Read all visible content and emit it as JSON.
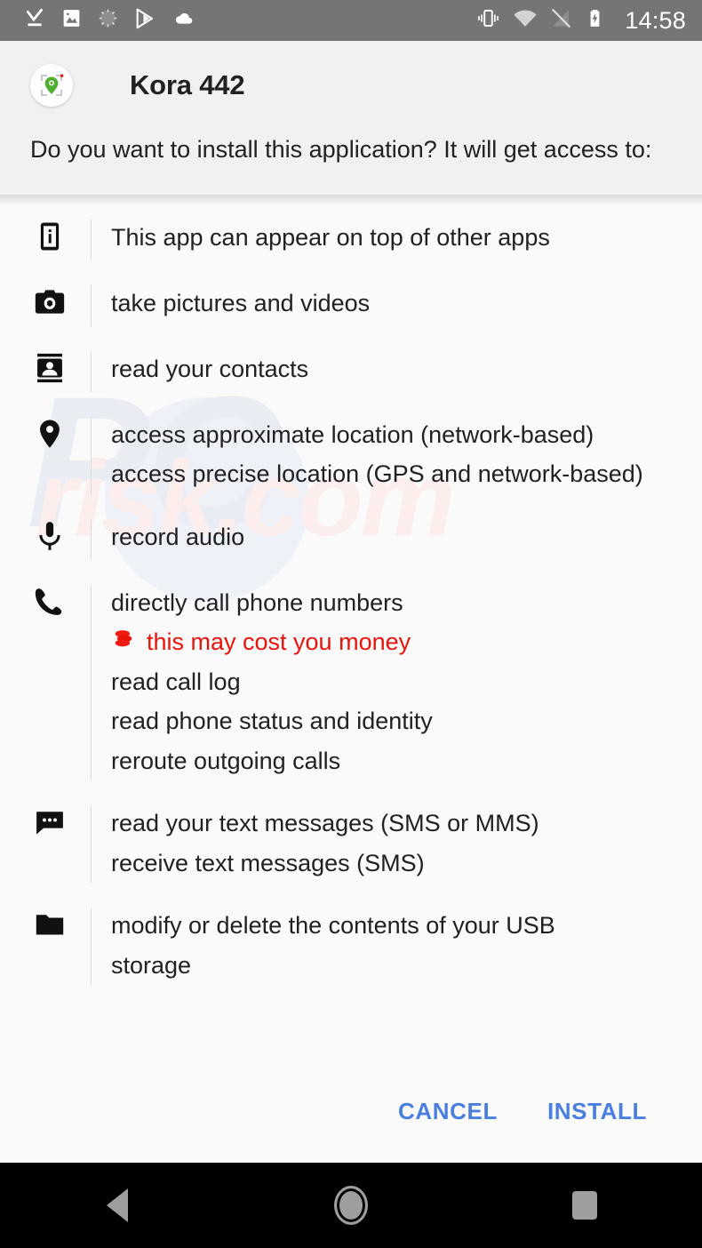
{
  "status_bar": {
    "background": "#757575",
    "left_icons": [
      {
        "name": "download-complete-icon",
        "label": "download complete"
      },
      {
        "name": "screenshot-image-icon",
        "label": "screenshot"
      },
      {
        "name": "loading-spinner-icon",
        "label": "syncing"
      },
      {
        "name": "google-play-icon",
        "label": "Google Play"
      },
      {
        "name": "cloud-icon",
        "label": "cloud"
      }
    ],
    "right_icons": [
      {
        "name": "vibrate-mode-icon",
        "label": "vibrate"
      },
      {
        "name": "wifi-icon",
        "label": "wifi"
      },
      {
        "name": "no-signal-icon",
        "label": "no cellular signal"
      },
      {
        "name": "battery-charging-icon",
        "label": "battery charging"
      }
    ],
    "clock": "14:58"
  },
  "header": {
    "background": "#f1f1f1",
    "app_name": "Kora 442",
    "app_icon_name": "kora-app-icon",
    "prompt": "Do you want to install this application? It will get access to:"
  },
  "permissions": [
    {
      "icon": "appear-on-top-icon",
      "lines": [
        {
          "text": "This app can appear on top of other apps",
          "warning": false
        }
      ]
    },
    {
      "icon": "camera-icon",
      "lines": [
        {
          "text": "take pictures and videos",
          "warning": false
        }
      ]
    },
    {
      "icon": "contacts-icon",
      "lines": [
        {
          "text": "read your contacts",
          "warning": false
        }
      ]
    },
    {
      "icon": "location-pin-icon",
      "lines": [
        {
          "text": "access approximate location (network-based)",
          "warning": false
        },
        {
          "text": "access precise location (GPS and network-based)",
          "warning": false
        }
      ]
    },
    {
      "icon": "microphone-icon",
      "lines": [
        {
          "text": "record audio",
          "warning": false
        }
      ]
    },
    {
      "icon": "phone-call-icon",
      "lines": [
        {
          "text": "directly call phone numbers",
          "warning": false
        },
        {
          "text": "this may cost you money",
          "warning": true,
          "warning_icon": "coins-icon"
        },
        {
          "text": "read call log",
          "warning": false
        },
        {
          "text": "read phone status and identity",
          "warning": false
        },
        {
          "text": "reroute outgoing calls",
          "warning": false
        }
      ]
    },
    {
      "icon": "sms-message-icon",
      "lines": [
        {
          "text": "read your text messages (SMS or MMS)",
          "warning": false
        },
        {
          "text": "receive text messages (SMS)",
          "warning": false
        }
      ]
    },
    {
      "icon": "folder-storage-icon",
      "lines": [
        {
          "text": "modify or delete the contents of your USB",
          "warning": false
        },
        {
          "text": "storage",
          "warning": false,
          "clipped": true
        }
      ]
    }
  ],
  "buttons": {
    "cancel_label": "CANCEL",
    "install_label": "INSTALL",
    "accent_color": "#4a7fe0"
  },
  "nav_bar": {
    "background": "#000000",
    "icon_color": "#9e9e9e",
    "items": [
      {
        "name": "nav-back-button",
        "label": "Back"
      },
      {
        "name": "nav-home-button",
        "label": "Home"
      },
      {
        "name": "nav-recents-button",
        "label": "Recent apps"
      }
    ]
  },
  "watermark": {
    "part1": "PC",
    "part2": "risk.com"
  },
  "colors": {
    "warning_red": "#e8140c",
    "body_background": "#fafafa",
    "text_primary": "#202124"
  }
}
